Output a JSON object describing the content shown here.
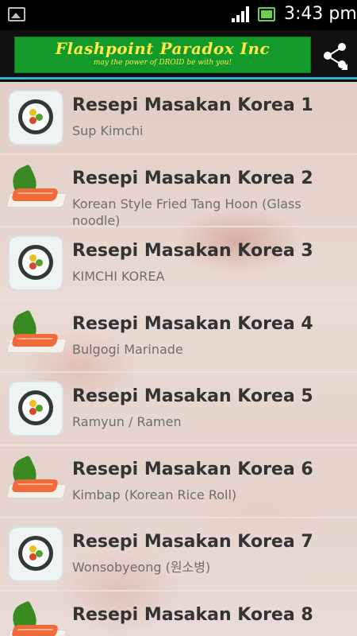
{
  "status": {
    "time": "3:43 pm"
  },
  "banner": {
    "title": "Flashpoint Paradox Inc",
    "tagline": "may the power of DROID be with you!"
  },
  "actions": {
    "share_icon": "share-icon"
  },
  "items": [
    {
      "title": "Resepi Masakan Korea 1",
      "subtitle": "Sup Kimchi",
      "icon": "sushi"
    },
    {
      "title": "Resepi Masakan Korea 2",
      "subtitle": "Korean Style Fried Tang Hoon (Glass noodle)",
      "icon": "salmon"
    },
    {
      "title": "Resepi Masakan Korea 3",
      "subtitle": "KIMCHI KOREA",
      "icon": "sushi"
    },
    {
      "title": "Resepi Masakan Korea 4",
      "subtitle": "Bulgogi Marinade",
      "icon": "salmon"
    },
    {
      "title": "Resepi Masakan Korea 5",
      "subtitle": "Ramyun / Ramen",
      "icon": "sushi"
    },
    {
      "title": "Resepi Masakan Korea 6",
      "subtitle": "Kimbap (Korean Rice Roll)",
      "icon": "salmon"
    },
    {
      "title": "Resepi Masakan Korea 7",
      "subtitle": "Wonsobyeong (원소병)",
      "icon": "sushi"
    },
    {
      "title": "Resepi Masakan Korea 8",
      "subtitle": "",
      "icon": "salmon"
    }
  ],
  "colors": {
    "accent": "#35b0e0",
    "banner_bg": "#129a2a",
    "banner_text": "#ffe94a"
  }
}
